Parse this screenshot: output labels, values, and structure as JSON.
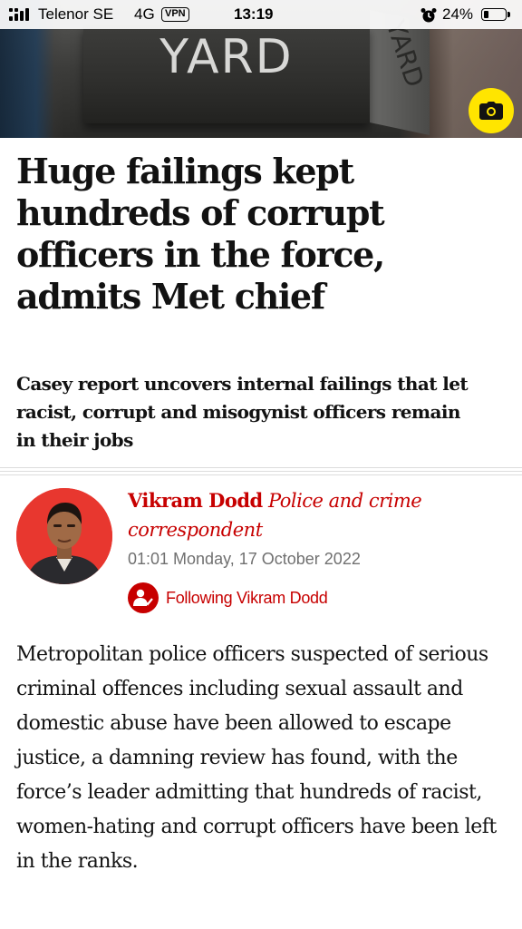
{
  "status_bar": {
    "carrier": "Telenor SE",
    "network": "4G",
    "vpn_label": "VPN",
    "time": "13:19",
    "battery_percent": "24%",
    "battery_level": 0.24
  },
  "hero": {
    "sign_text_front": "YARD",
    "sign_text_side": "YARD",
    "camera_icon": "camera-icon",
    "camera_color": "#ffe500"
  },
  "article": {
    "headline": "Huge failings kept hundreds of corrupt officers in the force, admits Met chief",
    "standfirst": "Casey report uncovers internal failings that let racist, corrupt and misogynist officers remain in their jobs",
    "author_name": "Vikram Dodd",
    "author_role": "Police and crime correspondent",
    "dateline": "01:01 Monday, 17 October 2022",
    "follow_label": "Following Vikram Dodd",
    "body": "Metropolitan police officers suspected of serious criminal offences including sexual assault and domestic abuse have been allowed to escape justice, a damning review has found, with the force’s leader admitting that hundreds of racist, women-hating and corrupt officers have been left in the ranks."
  },
  "colors": {
    "accent_red": "#c70000",
    "avatar_background": "#e8372f",
    "headline_text": "#121212",
    "meta_grey": "#707070"
  }
}
